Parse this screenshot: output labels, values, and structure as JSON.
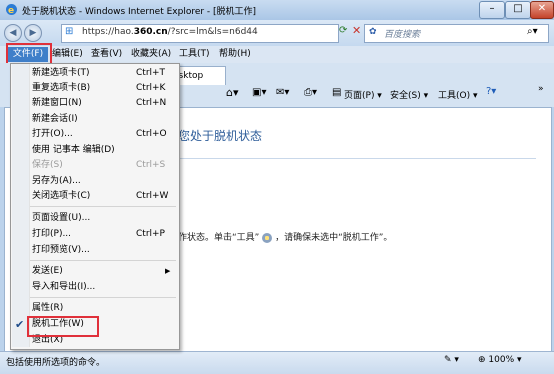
{
  "window": {
    "title": "处于脱机状态 - Windows Internet Explorer - [脱机工作]",
    "minimize": "–",
    "maximize": "□",
    "close": "✕"
  },
  "address": {
    "url_prefix": "https://hao.",
    "url_domain": "360.cn",
    "url_suffix": "/?src=lm&ls=n6d44",
    "search_placeholder": "百度搜索"
  },
  "menubar": [
    "文件(F)",
    "编辑(E)",
    "查看(V)",
    "收藏夹(A)",
    "工具(T)",
    "帮助(H)"
  ],
  "tab": {
    "label": "esktop"
  },
  "commandbar": {
    "page": "页面(P) ▾",
    "safety": "安全(S) ▾",
    "tools": "工具(O) ▾",
    "more": "»"
  },
  "content": {
    "title": "您处于脱机状态",
    "msg_prefix": "作状态。单击“工具”",
    "msg_suffix": "，请确保未选中“脱机工作”。"
  },
  "file_menu": [
    {
      "label": "新建选项卡(T)",
      "shortcut": "Ctrl+T"
    },
    {
      "label": "重复选项卡(B)",
      "shortcut": "Ctrl+K"
    },
    {
      "label": "新建窗口(N)",
      "shortcut": "Ctrl+N"
    },
    {
      "label": "新建会话(I)",
      "shortcut": ""
    },
    {
      "label": "打开(O)...",
      "shortcut": "Ctrl+O"
    },
    {
      "label": "使用 记事本 编辑(D)",
      "shortcut": ""
    },
    {
      "label": "保存(S)",
      "shortcut": "Ctrl+S"
    },
    {
      "label": "另存为(A)...",
      "shortcut": ""
    },
    {
      "label": "关闭选项卡(C)",
      "shortcut": "Ctrl+W"
    },
    {
      "label": "页面设置(U)...",
      "shortcut": ""
    },
    {
      "label": "打印(P)...",
      "shortcut": "Ctrl+P"
    },
    {
      "label": "打印预览(V)...",
      "shortcut": ""
    },
    {
      "label": "发送(E)",
      "shortcut": ""
    },
    {
      "label": "导入和导出(I)...",
      "shortcut": ""
    },
    {
      "label": "属性(R)",
      "shortcut": ""
    },
    {
      "label": "脱机工作(W)",
      "shortcut": ""
    },
    {
      "label": "退出(X)",
      "shortcut": ""
    }
  ],
  "status": {
    "text": "包括使用所选项的命令。",
    "zoom": "100%"
  }
}
